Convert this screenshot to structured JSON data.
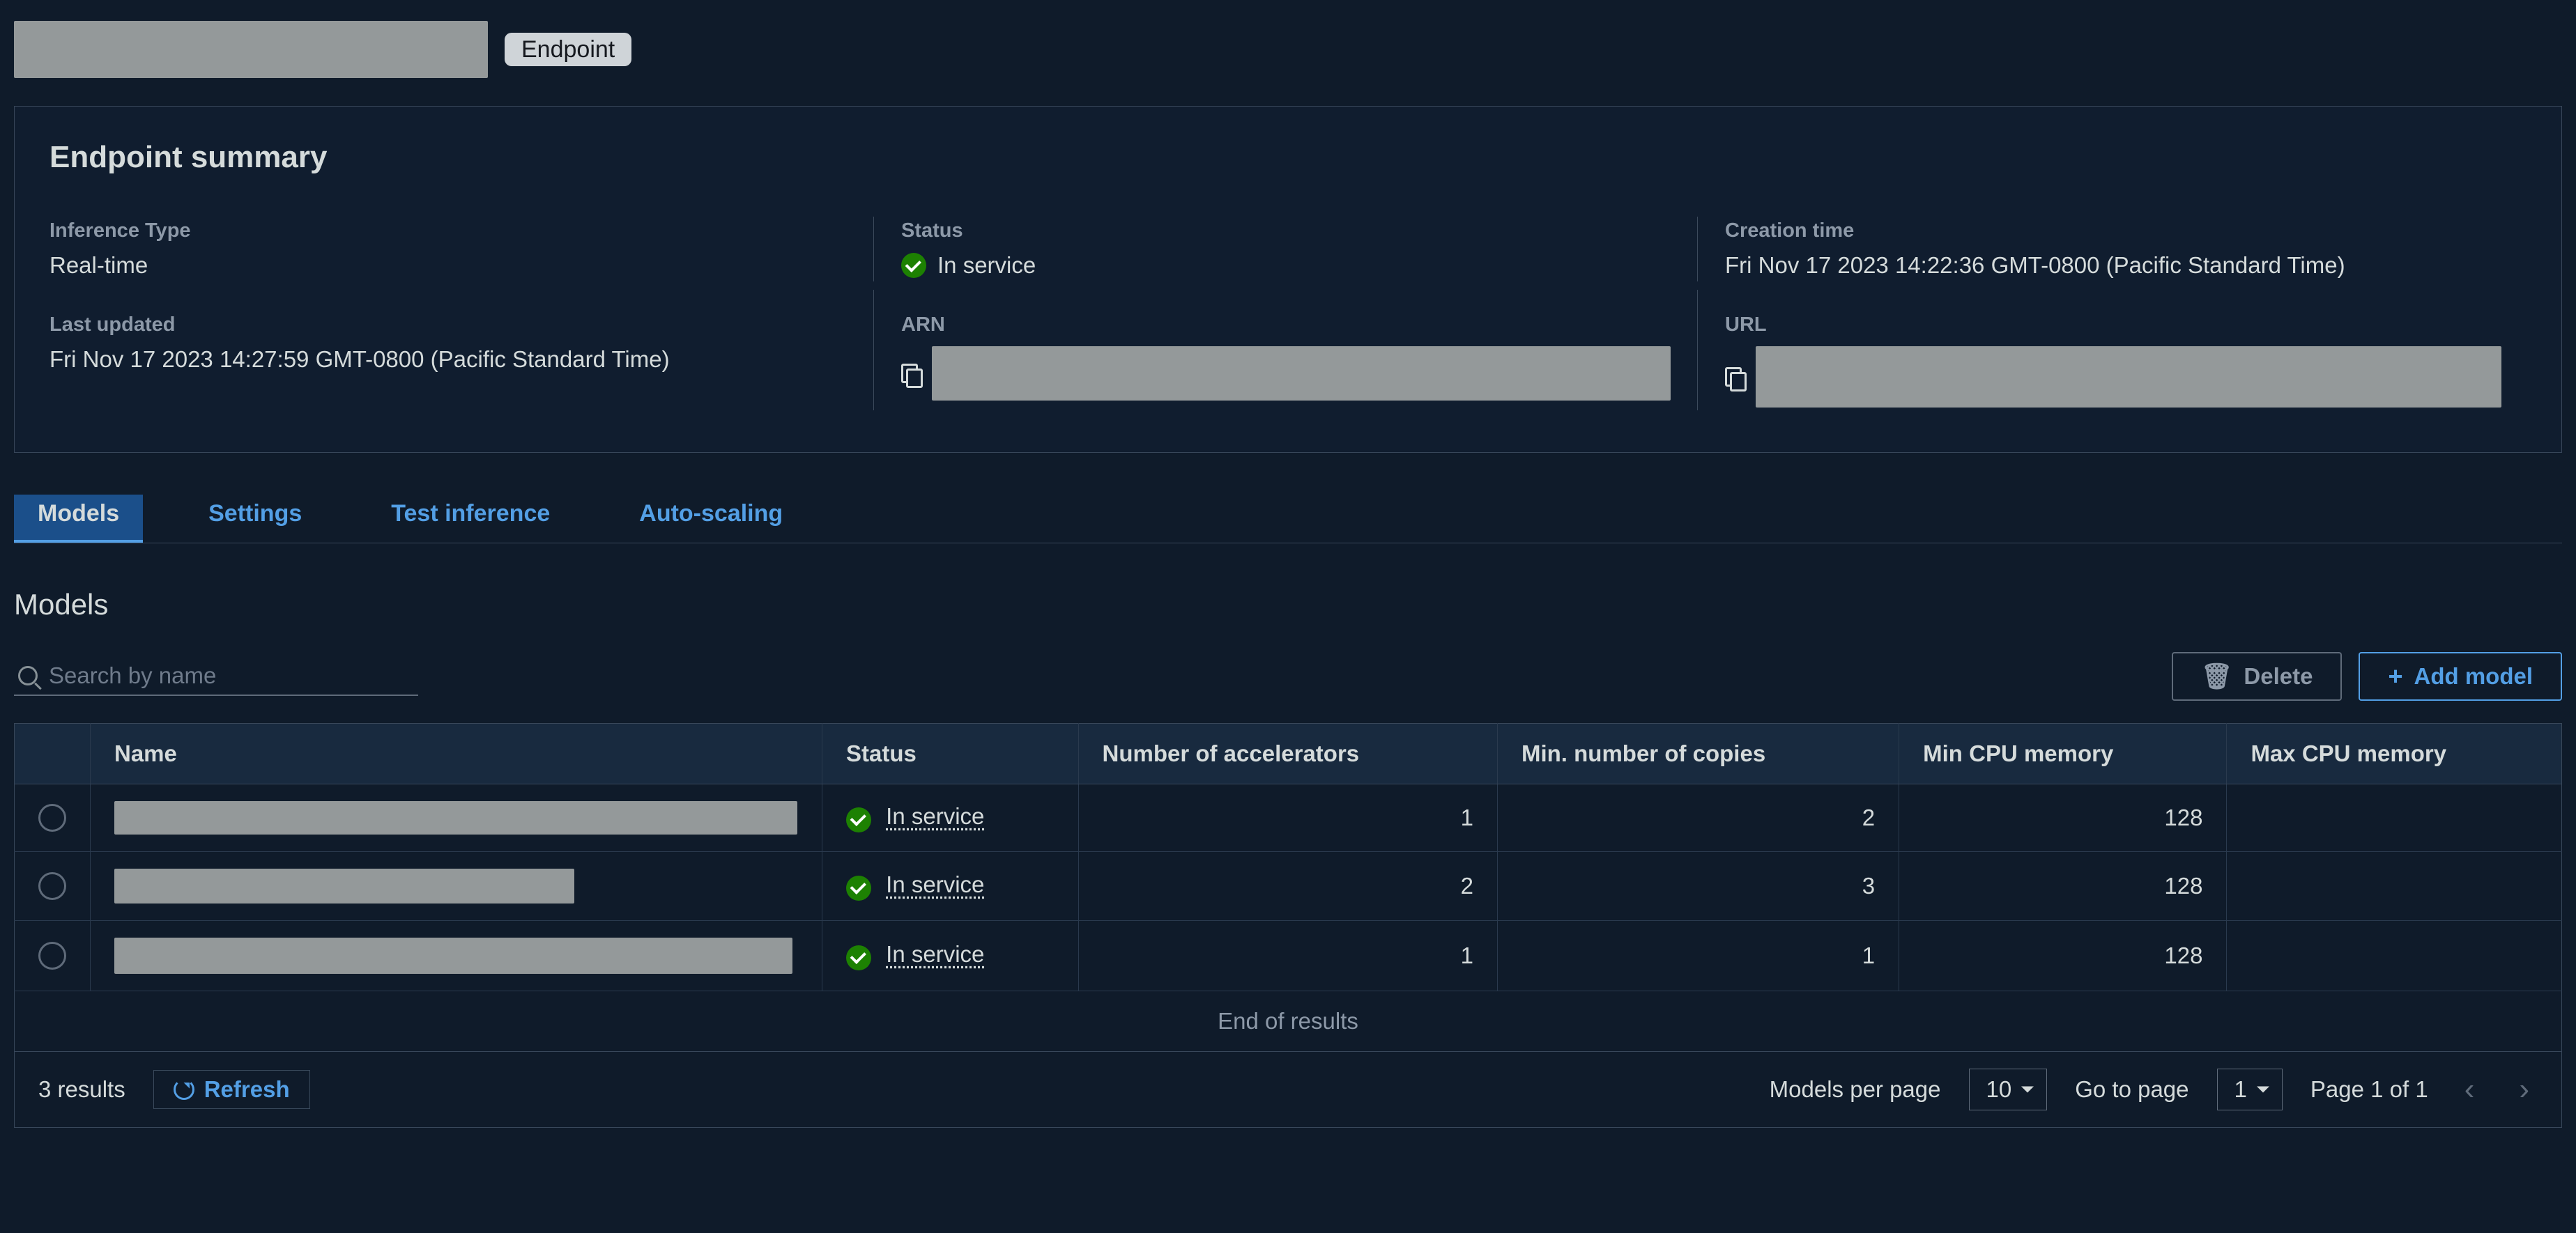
{
  "breadcrumb": {
    "badge": "Endpoint"
  },
  "summary": {
    "title": "Endpoint summary",
    "labels": {
      "inference_type": "Inference Type",
      "status": "Status",
      "creation_time": "Creation time",
      "last_updated": "Last updated",
      "arn": "ARN",
      "url": "URL"
    },
    "values": {
      "inference_type": "Real-time",
      "status": "In service",
      "creation_time": "Fri Nov 17 2023 14:22:36 GMT-0800 (Pacific Standard Time)",
      "last_updated": "Fri Nov 17 2023 14:27:59 GMT-0800 (Pacific Standard Time)"
    }
  },
  "tabs": {
    "models": "Models",
    "settings": "Settings",
    "test_inference": "Test inference",
    "auto_scaling": "Auto-scaling"
  },
  "models_section": {
    "title": "Models",
    "search_placeholder": "Search by name",
    "delete_label": "Delete",
    "add_label": "Add model",
    "columns": {
      "name": "Name",
      "status": "Status",
      "num_accel": "Number of accelerators",
      "min_copies": "Min. number of copies",
      "min_mem": "Min CPU memory",
      "max_mem": "Max CPU memory"
    },
    "rows": [
      {
        "status": "In service",
        "accel": "1",
        "min_copies": "2",
        "min_mem": "128",
        "max_mem": ""
      },
      {
        "status": "In service",
        "accel": "2",
        "min_copies": "3",
        "min_mem": "128",
        "max_mem": ""
      },
      {
        "status": "In service",
        "accel": "1",
        "min_copies": "1",
        "min_mem": "128",
        "max_mem": ""
      }
    ],
    "end_of_results": "End of results"
  },
  "footer": {
    "results": "3 results",
    "refresh": "Refresh",
    "models_per_page_label": "Models per page",
    "models_per_page_value": "10",
    "go_to_page_label": "Go to page",
    "go_to_page_value": "1",
    "page_info": "Page 1 of 1"
  }
}
